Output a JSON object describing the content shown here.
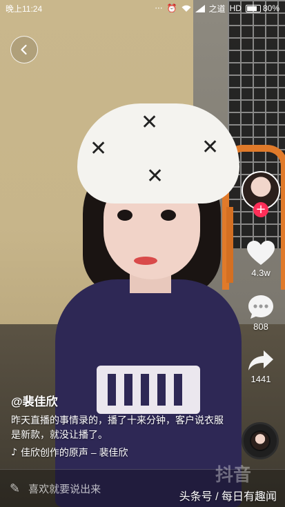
{
  "status_bar": {
    "time": "晚上11:24",
    "notifications": "···",
    "carrier": "之道",
    "network": "HD",
    "battery_percent": "80%",
    "battery_level": 0.8
  },
  "video": {
    "author": "@裴佳欣",
    "description": "昨天直播的事情录的，播了十来分钟，客户说衣服是新款，就没让播了。",
    "music": "佳欣创作的原声 – 裴佳欣"
  },
  "actions": {
    "likes": "4.3w",
    "comments": "808",
    "shares": "1441"
  },
  "comment_bar": {
    "placeholder": "喜欢就要说出来"
  },
  "watermark": {
    "logo": "抖音",
    "source": "头条号 / 每日有趣闻"
  },
  "icons": {
    "back": "chevron-left-icon",
    "like": "heart-icon",
    "comment": "chat-bubble-icon",
    "share": "share-arrow-icon",
    "music": "music-note-icon",
    "edit": "pencil-icon",
    "follow": "plus-icon"
  }
}
